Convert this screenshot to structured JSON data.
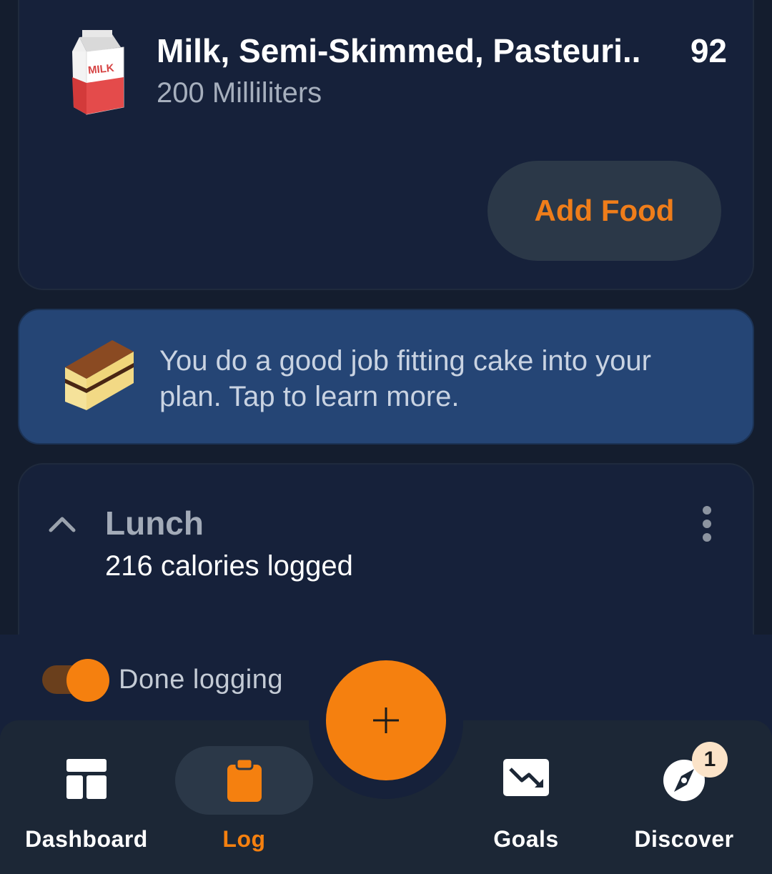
{
  "food_entry": {
    "name": "Milk, Semi-Skimmed, Pasteuri..",
    "quantity": "200 Milliliters",
    "calories": "92",
    "icon": "milk-carton-icon",
    "carton_text": "MILK",
    "add_food_label": "Add Food"
  },
  "insight": {
    "icon": "cake-icon",
    "text": "You do a good job fitting cake into your plan. Tap to learn more."
  },
  "lunch": {
    "title": "Lunch",
    "subtitle": "216 calories logged"
  },
  "done_logging": {
    "label": "Done logging",
    "toggled": true
  },
  "fab": {
    "icon": "plus-icon"
  },
  "nav": {
    "items": [
      {
        "label": "Dashboard",
        "icon": "dashboard-icon"
      },
      {
        "label": "Log",
        "icon": "clipboard-icon",
        "active": true
      },
      {
        "label": "Goals",
        "icon": "trend-down-icon"
      },
      {
        "label": "Discover",
        "icon": "compass-icon",
        "badge": "1"
      }
    ]
  },
  "colors": {
    "background": "#141d2e",
    "card": "#16213a",
    "accent": "#f5800f",
    "insight_bg": "#254575"
  }
}
